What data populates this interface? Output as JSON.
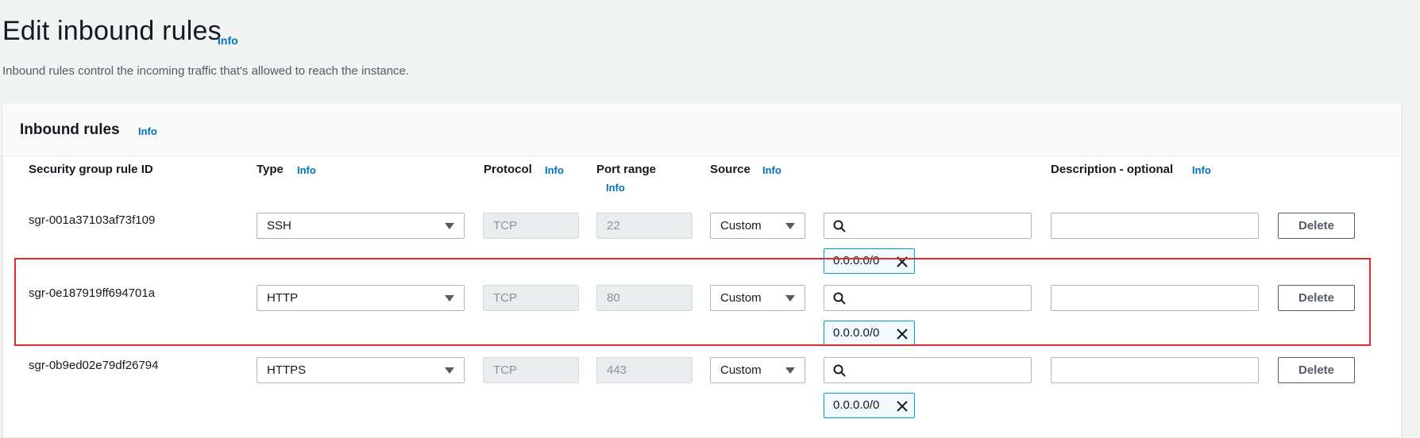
{
  "page": {
    "title": "Edit inbound rules",
    "title_info": "Info",
    "subtitle": "Inbound rules control the incoming traffic that's allowed to reach the instance."
  },
  "panel": {
    "title": "Inbound rules",
    "info": "Info"
  },
  "columns": {
    "rule_id": "Security group rule ID",
    "type": "Type",
    "type_info": "Info",
    "protocol": "Protocol",
    "protocol_info": "Info",
    "port_range": "Port range",
    "port_range_info": "Info",
    "source": "Source",
    "source_info": "Info",
    "description": "Description - optional",
    "description_info": "Info"
  },
  "rules": [
    {
      "id": "sgr-001a37103af73f109",
      "type": "SSH",
      "protocol": "TCP",
      "port_range": "22",
      "source": "Custom",
      "search_value": "",
      "cidr": "0.0.0.0/0",
      "description": "",
      "delete_label": "Delete"
    },
    {
      "id": "sgr-0e187919ff694701a",
      "type": "HTTP",
      "protocol": "TCP",
      "port_range": "80",
      "source": "Custom",
      "search_value": "",
      "cidr": "0.0.0.0/0",
      "description": "",
      "delete_label": "Delete"
    },
    {
      "id": "sgr-0b9ed02e79df26794",
      "type": "HTTPS",
      "protocol": "TCP",
      "port_range": "443",
      "source": "Custom",
      "search_value": "",
      "cidr": "0.0.0.0/0",
      "description": "",
      "delete_label": "Delete"
    }
  ],
  "colors": {
    "link": "#0073bb",
    "highlight": "#e02b2b",
    "token_border": "#00a1c9"
  }
}
